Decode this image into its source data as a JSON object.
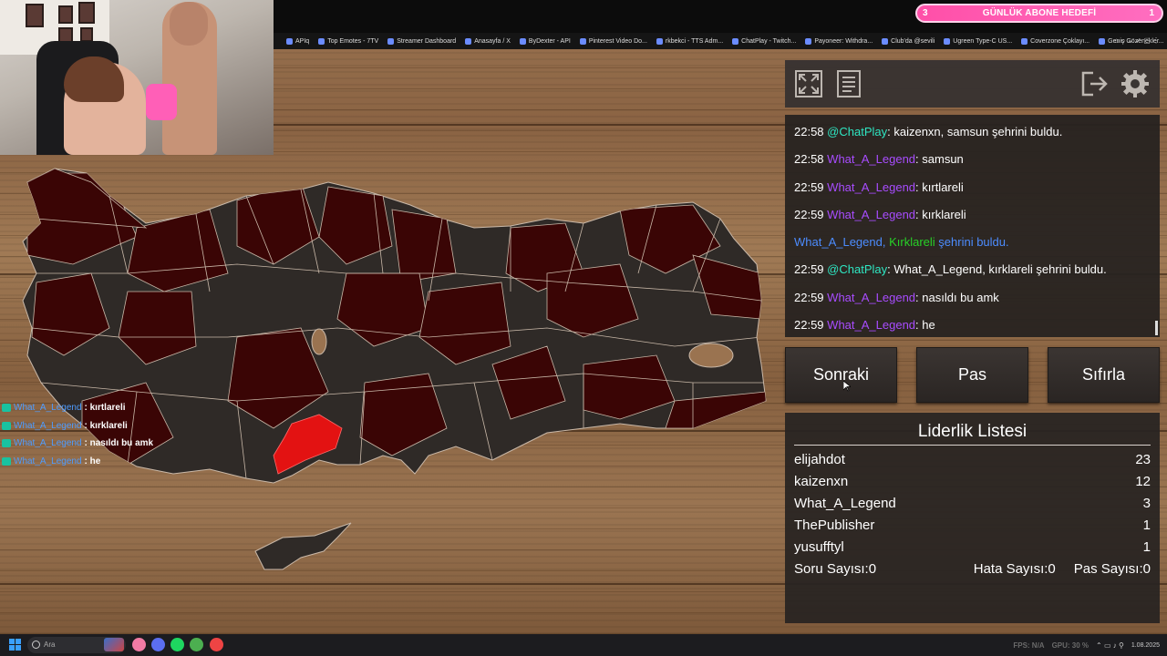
{
  "browser": {
    "bookmarks": [
      "APIq",
      "Top Emotes - 7TV",
      "Streamer Dashboard",
      "Anasayfa / X",
      "ByDexter - API",
      "Pinterest Video Do...",
      "rkbekci - TTS Adm...",
      "ChatPlay - Twitch...",
      "Payoneer: Withdra...",
      "Club'da @sevili",
      "Ugreen Type-C US...",
      "Coverzone Çoklayı...",
      "Geniş Gözenekler..."
    ]
  },
  "goal": {
    "current": "3",
    "title": "GÜNLÜK ABONE HEDEFİ",
    "target": "1"
  },
  "overlay_chat": [
    {
      "user": "What_A_Legend",
      "message": ": kırtlareli"
    },
    {
      "user": "What_A_Legend",
      "message": ": kırklareli"
    },
    {
      "user": "What_A_Legend",
      "message": ": nasıldı bu amk"
    },
    {
      "user": "What_A_Legend",
      "message": ": he"
    }
  ],
  "chat": [
    {
      "time": "22:58",
      "user": "@ChatPlay",
      "kind": "bot",
      "text": ": kaizenxn, samsun şehrini buldu."
    },
    {
      "time": "22:58",
      "user": "What_A_Legend",
      "kind": "user",
      "text": ": samsun"
    },
    {
      "time": "22:59",
      "user": "What_A_Legend",
      "kind": "user",
      "text": ": kırtlareli"
    },
    {
      "time": "22:59",
      "user": "What_A_Legend",
      "kind": "user",
      "text": ": kırklareli"
    },
    {
      "kind": "system",
      "user": "What_A_Legend,",
      "city": "Kırklareli",
      "text": "şehrini buldu."
    },
    {
      "time": "22:59",
      "user": "@ChatPlay",
      "kind": "bot",
      "text": ": What_A_Legend, kırklareli şehrini buldu."
    },
    {
      "time": "22:59",
      "user": "What_A_Legend",
      "kind": "user",
      "text": ": nasıldı bu amk"
    },
    {
      "time": "22:59",
      "user": "What_A_Legend",
      "kind": "user",
      "text": ": he"
    }
  ],
  "buttons": {
    "next": "Sonraki",
    "pass": "Pas",
    "reset": "Sıfırla"
  },
  "leaderboard": {
    "title": "Liderlik Listesi",
    "rows": [
      {
        "name": "elijahdot",
        "score": "23"
      },
      {
        "name": "kaizenxn",
        "score": "12"
      },
      {
        "name": "What_A_Legend",
        "score": "3"
      },
      {
        "name": "ThePublisher",
        "score": "1"
      },
      {
        "name": "yusufftyl",
        "score": "1"
      }
    ],
    "question_count": "Soru Sayısı:0",
    "error_count": "Hata Sayısı:0",
    "pass_count": "Pas Sayısı:0"
  },
  "taskbar": {
    "search_placeholder": "Ara",
    "fps": "FPS: N/A",
    "gpu": "GPU: 30 %",
    "date": "1.08.2025"
  },
  "colors": {
    "found_province": "#3a0505",
    "unfound_province": "#2f2a27",
    "highlight": "#e31212",
    "goal_bar": "#ff5fb7"
  }
}
